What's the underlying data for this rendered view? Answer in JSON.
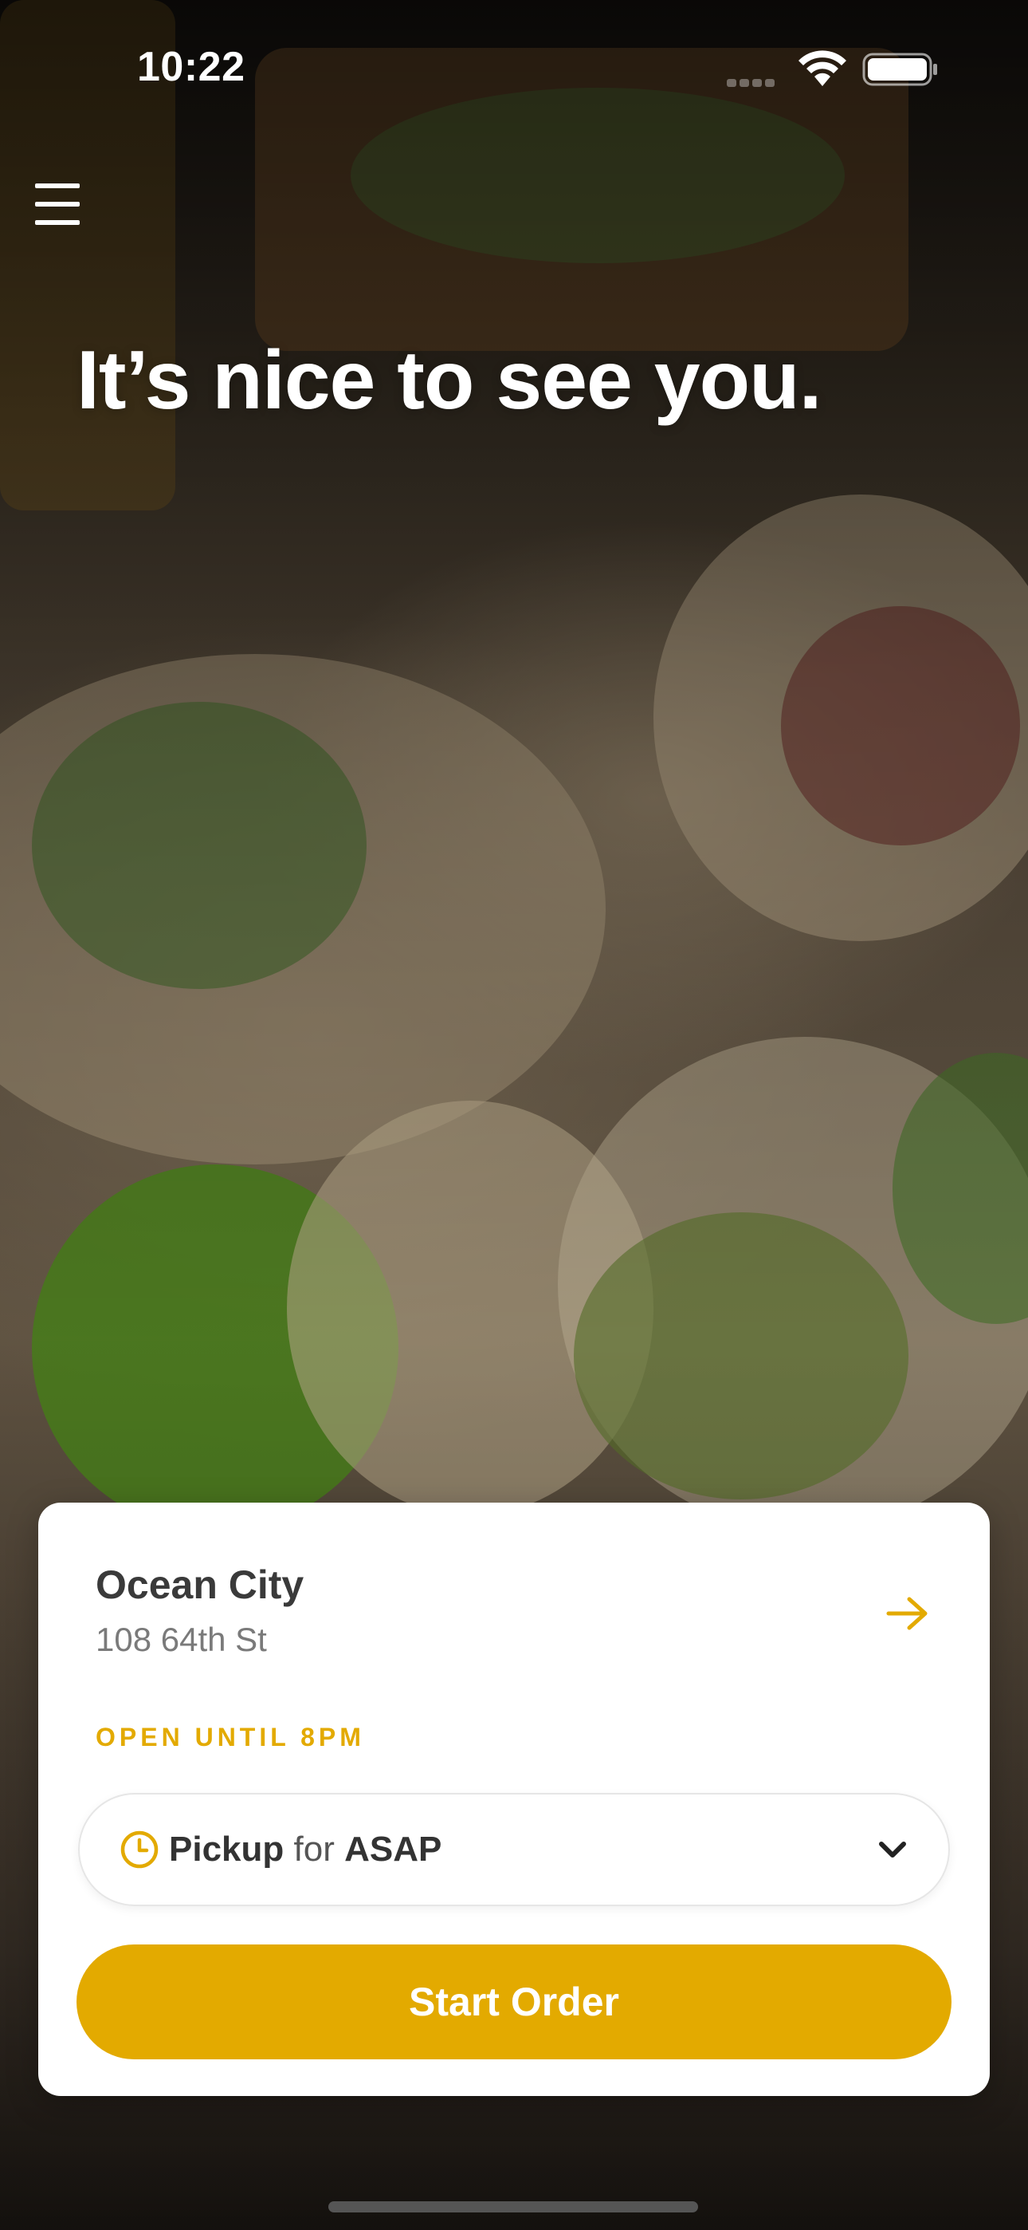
{
  "status_bar": {
    "time": "10:22"
  },
  "header": {
    "menu_icon": "hamburger-menu-icon",
    "greeting": "It’s nice to see you."
  },
  "location_card": {
    "name": "Ocean City",
    "address": "108 64th St",
    "arrow_icon": "arrow-right-icon",
    "hours": "OPEN UNTIL 8PM",
    "order_type": {
      "method": "Pickup",
      "connector": "for",
      "time": "ASAP",
      "icon": "clock-icon"
    },
    "start_button_label": "Start Order"
  },
  "colors": {
    "accent": "#e3aa00",
    "card_bg": "#ffffff",
    "name_text": "#3a3a3a",
    "address_text": "#7a7a7a"
  }
}
